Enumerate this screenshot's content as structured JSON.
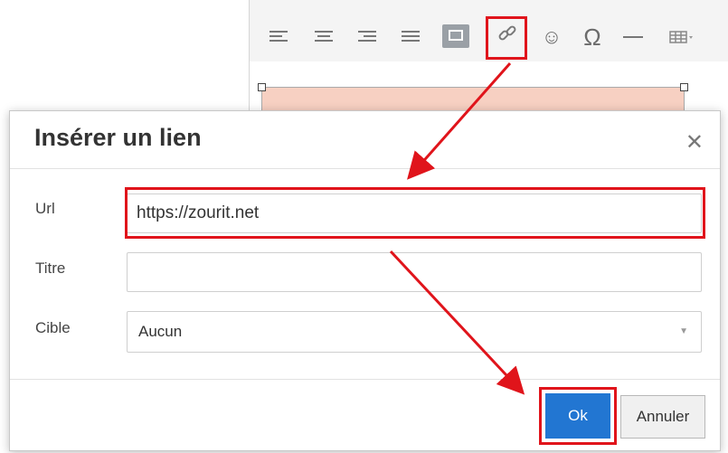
{
  "dialog": {
    "title": "Insérer un lien",
    "close_icon": "close-icon",
    "fields": {
      "url_label": "Url",
      "url_value": "https://zourit.net",
      "title_label": "Titre",
      "title_value": "",
      "target_label": "Cible",
      "target_value": "Aucun"
    },
    "ok_label": "Ok",
    "cancel_label": "Annuler"
  },
  "toolbar": {
    "icons": [
      "align-left-icon",
      "align-center-icon",
      "align-right-icon",
      "align-justify-icon",
      "image-icon",
      "link-icon",
      "emoticon-icon",
      "special-char-icon",
      "horizontal-rule-icon",
      "table-icon"
    ],
    "omega_glyph": "Ω",
    "emoji_glyph": "☺"
  },
  "colors": {
    "highlight": "#e0141b",
    "primary_button": "#2276d2",
    "content_block": "#f7d0c2"
  }
}
